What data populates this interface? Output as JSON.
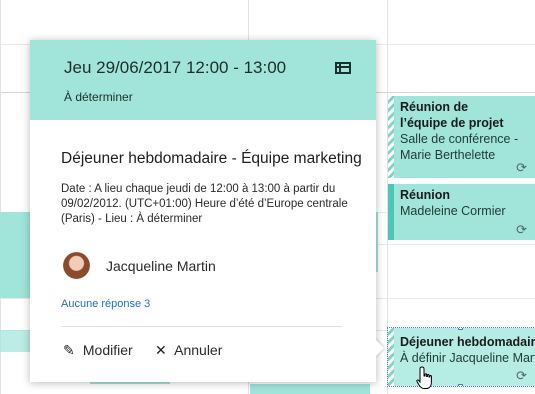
{
  "popup": {
    "datetime": "Jeu 29/06/2017 12:00 - 13:00",
    "location": "À déterminer",
    "title": "Déjeuner hebdomadaire - Équipe marketing",
    "description": "Date : A lieu chaque jeudi de 12:00 à 13:00 à partir du 09/02/2012. (UTC+01:00) Heure d’été d’Europe centrale (Paris) - Lieu : À déterminer",
    "organizer": "Jacqueline Martin",
    "responses": "Aucune réponse 3",
    "edit_label": "Modifier",
    "cancel_label": "Annuler"
  },
  "events": [
    {
      "title_line1": "Réunion de",
      "title_line2": "l’équipe de projet",
      "line3": "Salle de conférence -",
      "line4": "Marie Berthelette"
    },
    {
      "title": "Réunion",
      "line2": "Madeleine Cormier"
    },
    {
      "title": "Déjeuner hebdomadaire",
      "line2": "À définir Jacqueline Martin"
    }
  ],
  "colors": {
    "event_teal": "#a0e4da",
    "link_blue": "#1e6fc4"
  },
  "icons": {
    "popout": "calendar-popout-icon",
    "edit": "pencil-icon",
    "cancel": "close-icon",
    "recurring": "recurring-icon"
  }
}
